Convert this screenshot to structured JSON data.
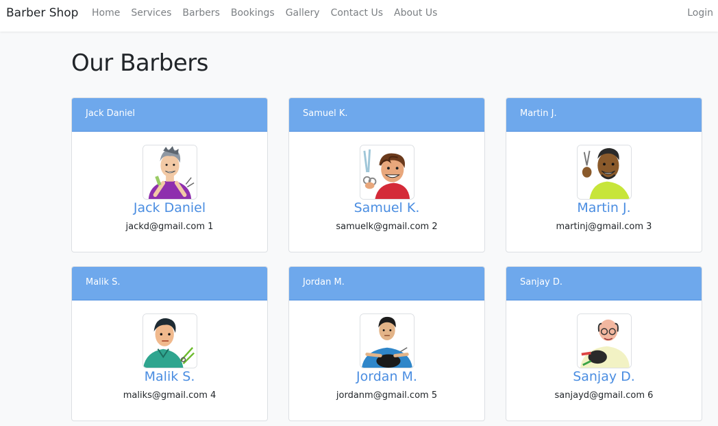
{
  "navbar": {
    "brand": "Barber Shop",
    "links": [
      {
        "label": "Home"
      },
      {
        "label": "Services"
      },
      {
        "label": "Barbers"
      },
      {
        "label": "Bookings"
      },
      {
        "label": "Gallery"
      },
      {
        "label": "Contact Us"
      },
      {
        "label": "About Us"
      }
    ],
    "login": "Login"
  },
  "page": {
    "title": "Our Barbers"
  },
  "barbers": [
    {
      "header": "Jack Daniel",
      "name": "Jack Daniel",
      "contact": "jackd@gmail.com 1",
      "avatar": "barber-avatar-gray-hair-purple-shirt"
    },
    {
      "header": "Samuel K.",
      "name": "Samuel K.",
      "contact": "samuelk@gmail.com 2",
      "avatar": "barber-avatar-brown-hair-red-shirt"
    },
    {
      "header": "Martin J.",
      "name": "Martin J.",
      "contact": "martinj@gmail.com 3",
      "avatar": "barber-avatar-dark-skin-lime-shirt"
    },
    {
      "header": "Malik S.",
      "name": "Malik S.",
      "contact": "maliks@gmail.com 4",
      "avatar": "barber-avatar-teal-shirt-scissors"
    },
    {
      "header": "Jordan M.",
      "name": "Jordan M.",
      "contact": "jordanm@gmail.com 5",
      "avatar": "barber-avatar-cutting-hair-blue"
    },
    {
      "header": "Sanjay D.",
      "name": "Sanjay D.",
      "contact": "sanjayd@gmail.com 6",
      "avatar": "barber-avatar-bald-glasses"
    }
  ],
  "colors": {
    "card_header": "#6ea8ec",
    "barber_name": "#4a8de1",
    "page_background": "#f8f9fa",
    "nav_text": "#7b7f83"
  }
}
